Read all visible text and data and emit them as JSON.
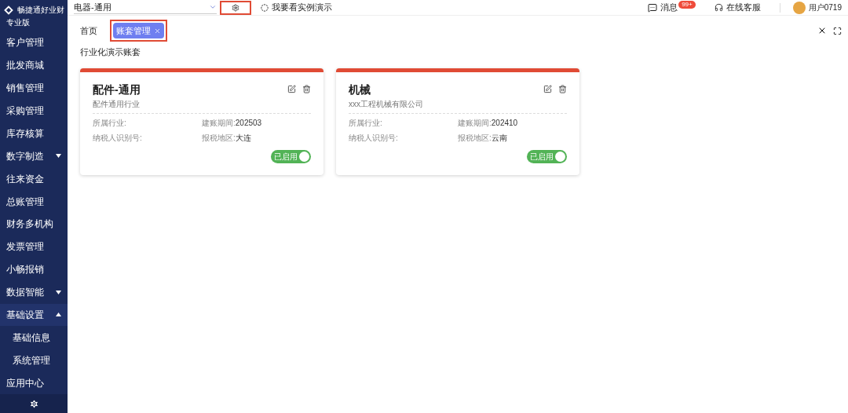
{
  "brand": {
    "name": "畅捷通好业财",
    "edition": "专业版"
  },
  "sidebar": {
    "items": [
      {
        "kind": "link",
        "label": "客户管理"
      },
      {
        "kind": "link",
        "label": "批发商城"
      },
      {
        "kind": "link",
        "label": "销售管理"
      },
      {
        "kind": "link",
        "label": "采购管理"
      },
      {
        "kind": "link",
        "label": "库存核算"
      },
      {
        "kind": "group",
        "label": "数字制造",
        "expanded": false
      },
      {
        "kind": "link",
        "label": "往来资金"
      },
      {
        "kind": "link",
        "label": "总账管理"
      },
      {
        "kind": "link",
        "label": "财务多机构"
      },
      {
        "kind": "link",
        "label": "发票管理"
      },
      {
        "kind": "link",
        "label": "小畅报销"
      },
      {
        "kind": "group",
        "label": "数据智能",
        "expanded": false
      },
      {
        "kind": "group",
        "label": "基础设置",
        "expanded": true,
        "children": [
          {
            "label": "基础信息"
          },
          {
            "label": "系统管理"
          }
        ]
      },
      {
        "kind": "link",
        "label": "应用中心"
      }
    ]
  },
  "topbar": {
    "account_select": "电器-通用",
    "demo_link": "我要看实例演示",
    "messages": "消息",
    "messages_badge": "99+",
    "support": "在线客服",
    "user": "用户0719"
  },
  "tabs": [
    {
      "label": "首页",
      "selected": false,
      "closable": false
    },
    {
      "label": "账套管理",
      "selected": true,
      "closable": true
    }
  ],
  "section_title": "行业化演示账套",
  "accounts": [
    {
      "name": "配件-通用",
      "company": "配件通用行业",
      "industry_label": "所属行业:",
      "period_label": "建账期间:",
      "period": "202503",
      "taxid_label": "纳税人识别号:",
      "region_label": "报税地区:",
      "region": "大连",
      "status": "已启用",
      "enabled": true
    },
    {
      "name": "机械",
      "company": "xxx工程机械有限公司",
      "industry_label": "所属行业:",
      "period_label": "建账期间:",
      "period": "202410",
      "taxid_label": "纳税人识别号:",
      "region_label": "报税地区:",
      "region": "云南",
      "status": "已启用",
      "enabled": true
    }
  ]
}
